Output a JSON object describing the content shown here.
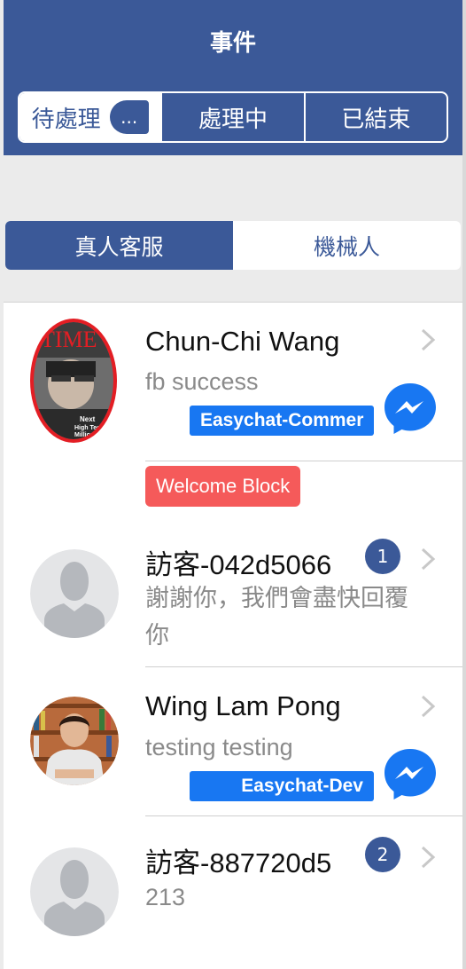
{
  "header": {
    "title": "事件",
    "tabs": [
      {
        "label": "待處理",
        "badge": "...",
        "active": true
      },
      {
        "label": "處理中",
        "active": false
      },
      {
        "label": "已結束",
        "active": false
      }
    ]
  },
  "agent_toggle": {
    "options": [
      {
        "label": "真人客服",
        "active": true
      },
      {
        "label": "機械人",
        "active": false
      }
    ]
  },
  "conversations": [
    {
      "name": "Chun-Chi Wang",
      "message": "fb success",
      "channel": "Easychat-Commer",
      "channel_icon": "messenger-icon",
      "avatar": "photo"
    },
    {
      "tag": "Welcome Block",
      "name": "訪客-042d5066",
      "unread": "1",
      "message": "謝謝你，我們會盡快回覆你",
      "avatar": "default-person-icon"
    },
    {
      "name": "Wing Lam Pong",
      "message": "testing testing",
      "channel": "Easychat-Dev",
      "channel_icon": "messenger-icon",
      "avatar": "photo"
    },
    {
      "name": "訪客-887720d5",
      "unread": "2",
      "message": "213",
      "avatar": "default-person-icon"
    }
  ],
  "colors": {
    "brand": "#3b5998",
    "messenger": "#1877f2",
    "welcome_tag": "#f55a5a"
  }
}
